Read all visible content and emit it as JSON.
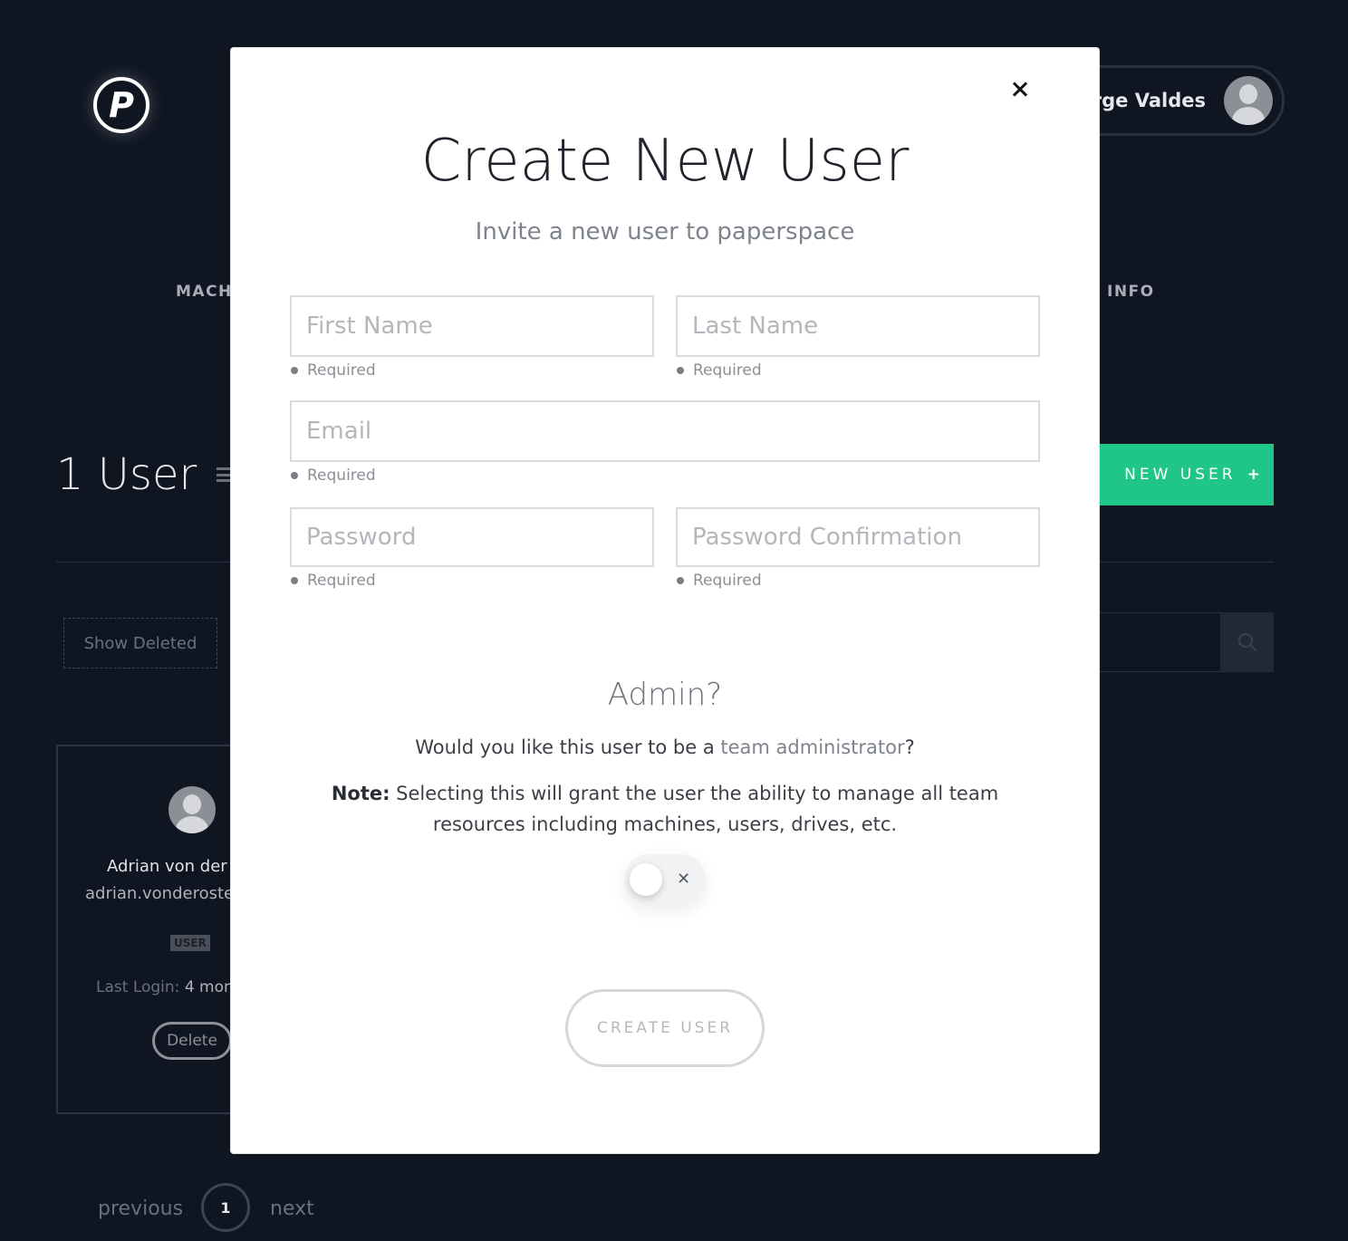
{
  "header": {
    "logo_letter": "P",
    "user_name": "rge Valdes"
  },
  "nav": {
    "left_partial": "MACH",
    "right_partial": "INFO"
  },
  "users_page": {
    "heading": "1 User",
    "new_user_label": "NEW USER",
    "new_user_icon": "+",
    "show_deleted_label": "Show Deleted",
    "search_icon": "search-icon"
  },
  "user_card": {
    "name": "Adrian von der",
    "email": "adrian.vonderoste",
    "role_badge": "USER",
    "last_login_label": "Last Login:",
    "last_login_value": "4 mon",
    "delete_label": "Delete"
  },
  "pagination": {
    "previous": "previous",
    "current_page": "1",
    "next": "next"
  },
  "modal": {
    "title": "Create New User",
    "subtitle": "Invite a new user to paperspace",
    "fields": {
      "first_name": {
        "placeholder": "First Name",
        "value": "",
        "hint": "Required"
      },
      "last_name": {
        "placeholder": "Last Name",
        "value": "",
        "hint": "Required"
      },
      "email": {
        "placeholder": "Email",
        "value": "",
        "hint": "Required"
      },
      "password": {
        "placeholder": "Password",
        "value": "",
        "hint": "Required"
      },
      "password_confirmation": {
        "placeholder": "Password Confirmation",
        "value": "",
        "hint": "Required"
      }
    },
    "admin": {
      "heading": "Admin?",
      "question_before": "Would you like this user to be a ",
      "question_link": "team administrator",
      "question_after": "?",
      "note_label": "Note:",
      "note_text": " Selecting this will grant the user the ability to manage all team resources including machines, users, drives, etc.",
      "toggle_state": "off",
      "toggle_off_symbol": "✕"
    },
    "submit_label": "CREATE USER"
  },
  "colors": {
    "background": "#0f1521",
    "accent_green": "#1fc589",
    "modal_bg": "#ffffff"
  }
}
